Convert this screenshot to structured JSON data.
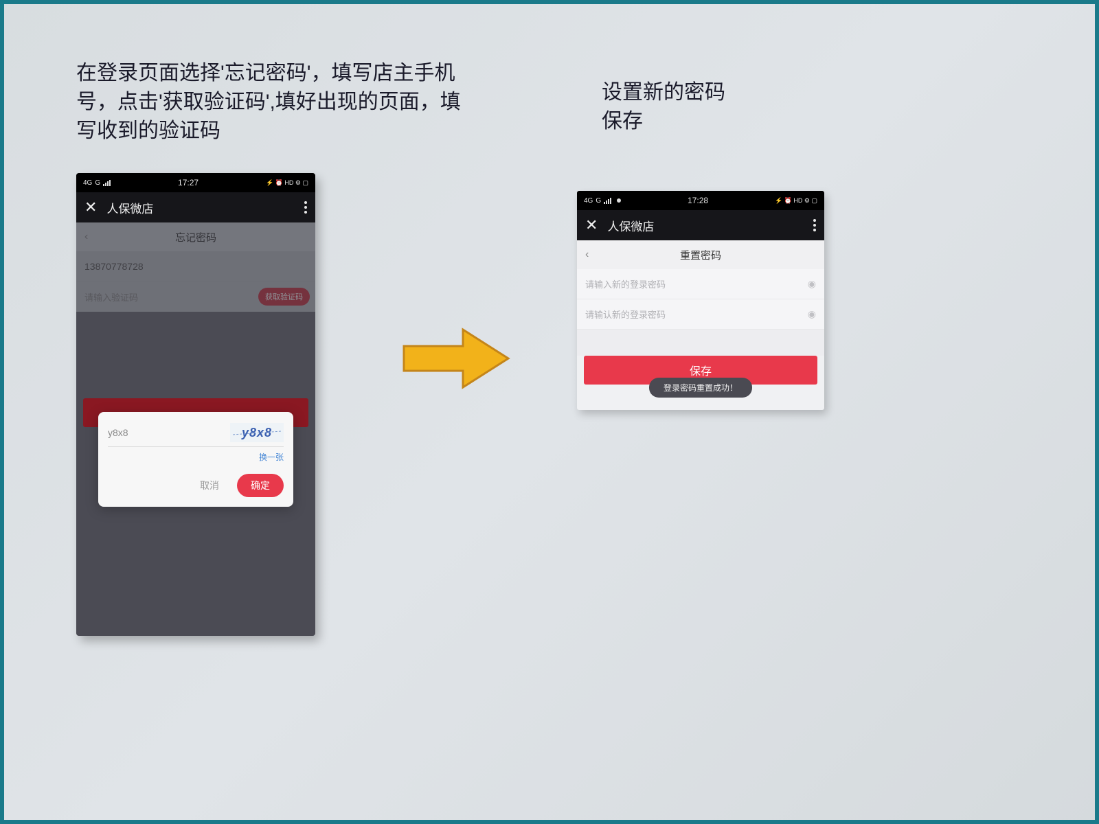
{
  "instructions": {
    "left": "在登录页面选择'忘记密码'，填写店主手机号，点击'获取验证码',填好出现的页面，填写收到的验证码",
    "right": "设置新的密码\n保存"
  },
  "left_phone": {
    "status": {
      "network": "4G",
      "signal": "G",
      "time": "17:27",
      "icons": "⚡ ⏰ HD ⚙ ▢"
    },
    "title": "人保微店",
    "page_title": "忘记密码",
    "phone_value": "13870778728",
    "code_placeholder": "请输入验证码",
    "get_code_label": "获取验证码",
    "captcha": {
      "input_value": "y8x8",
      "image_text": "y8x8",
      "change_label": "换一张",
      "cancel_label": "取消",
      "confirm_label": "确定"
    }
  },
  "right_phone": {
    "status": {
      "network": "4G",
      "signal": "G",
      "time": "17:28",
      "icons": "⚡ ⏰ HD ⚙ ▢"
    },
    "title": "人保微店",
    "page_title": "重置密码",
    "field1_placeholder": "请输入新的登录密码",
    "field2_placeholder": "请输认新的登录密码",
    "save_label": "保存",
    "toast": "登录密码重置成功！"
  }
}
